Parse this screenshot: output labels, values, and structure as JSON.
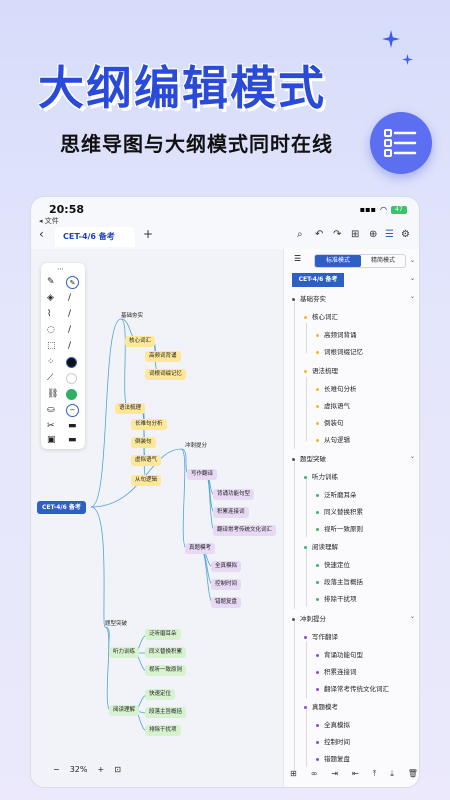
{
  "hero": {
    "title": "大纲编辑模式",
    "subtitle": "思维导图与大纲模式同时在线"
  },
  "status_bar": {
    "time": "20:58",
    "back_app": "◂ 文件",
    "battery": "47"
  },
  "toolbar": {
    "tab_title": "CET-4/6 备考"
  },
  "mindmap": {
    "root": "CET-4/6 备考",
    "nodes": {
      "basic": "基础夯实",
      "core_vocab": "核心词汇",
      "hf_vocab": "高频词背诵",
      "phrase": "词根词缀记忆",
      "grammar": "语法梳理",
      "long_sent": "长难句分析",
      "inversion": "倒装句",
      "virtual": "虚拟语气",
      "clause": "从句逻辑",
      "sprint": "冲刺提分",
      "writing": "写作翻译",
      "template": "背诵功能句型",
      "accumulate": "积累连接词",
      "culture": "翻译常考传统文化词汇",
      "mock": "真题模考",
      "full_mock": "全真模拟",
      "time_ctrl": "控制时间",
      "review": "错题复盘",
      "breakthrough": "题型突破",
      "listening": "听力训练",
      "ear_train": "泛听磨耳朵",
      "synonym": "同义替换积累",
      "sight": "视听一致原则",
      "reading": "阅读理解",
      "fast": "快速定位",
      "para": "段落主旨概括",
      "exclude": "排除干扰项"
    }
  },
  "zoom": {
    "level": "32%"
  },
  "outline": {
    "mode_standard": "标准模式",
    "mode_simple": "精简模式",
    "root": "CET-4/6 备考",
    "rows": [
      "基础夯实",
      "核心词汇",
      "高频词背诵",
      "词根词缀记忆",
      "语法梳理",
      "长难句分析",
      "虚拟语气",
      "倒装句",
      "从句逻辑",
      "题型突破",
      "听力训练",
      "泛听磨耳朵",
      "同义替换积累",
      "视听一致原则",
      "阅读理解",
      "快速定位",
      "段落主旨概括",
      "排除干扰项",
      "冲刺提分",
      "写作翻译",
      "背诵功能句型",
      "积累连接词",
      "翻译常考传统文化词汇",
      "真题模考",
      "全真模拟",
      "控制时间",
      "错题复盘"
    ]
  },
  "colors": {
    "accent": "#2d5fc4",
    "yellow_dot": "#f2b827",
    "green_dot": "#3bb56a",
    "purple_dot": "#8a4fd0"
  }
}
